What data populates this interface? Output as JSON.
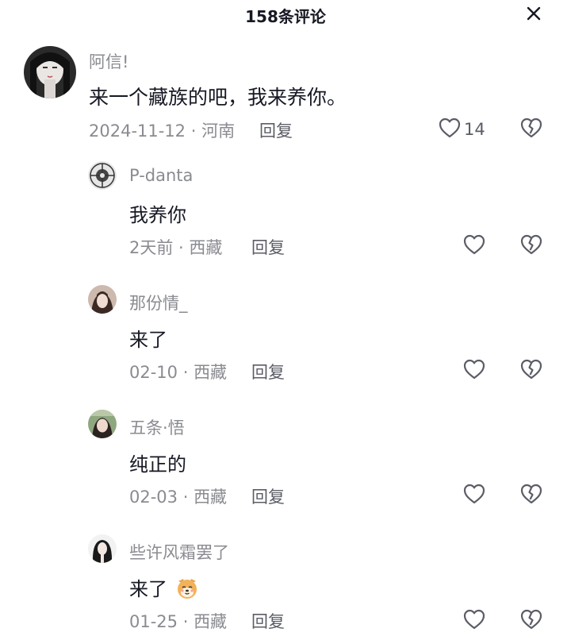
{
  "header": {
    "title": "158条评论",
    "close_icon": "close-icon"
  },
  "comments": [
    {
      "username": "阿信!",
      "text": "来一个藏族的吧，我来养你。",
      "date": "2024-11-12",
      "location": "河南",
      "reply_label": "回复",
      "likes": "14",
      "level": "top"
    },
    {
      "username": "P-danta",
      "text": "我养你",
      "date": "2天前",
      "location": "西藏",
      "reply_label": "回复",
      "likes": "",
      "level": "reply"
    },
    {
      "username": "那份情_​",
      "text": "来了",
      "date": "02-10",
      "location": "西藏",
      "reply_label": "回复",
      "likes": "",
      "level": "reply"
    },
    {
      "username": "五条·悟",
      "text": "纯正的",
      "date": "02-03",
      "location": "西藏",
      "reply_label": "回复",
      "likes": "",
      "level": "reply"
    },
    {
      "username": "些许风霜罢了",
      "text": "来了",
      "date": "01-25",
      "location": "西藏",
      "reply_label": "回复",
      "likes": "",
      "level": "reply",
      "emoji_icon": "shiba-dog-emoji-icon"
    }
  ],
  "meta_separator": " · ",
  "icons": {
    "like": "heart-outline-icon",
    "dislike": "broken-heart-icon"
  }
}
